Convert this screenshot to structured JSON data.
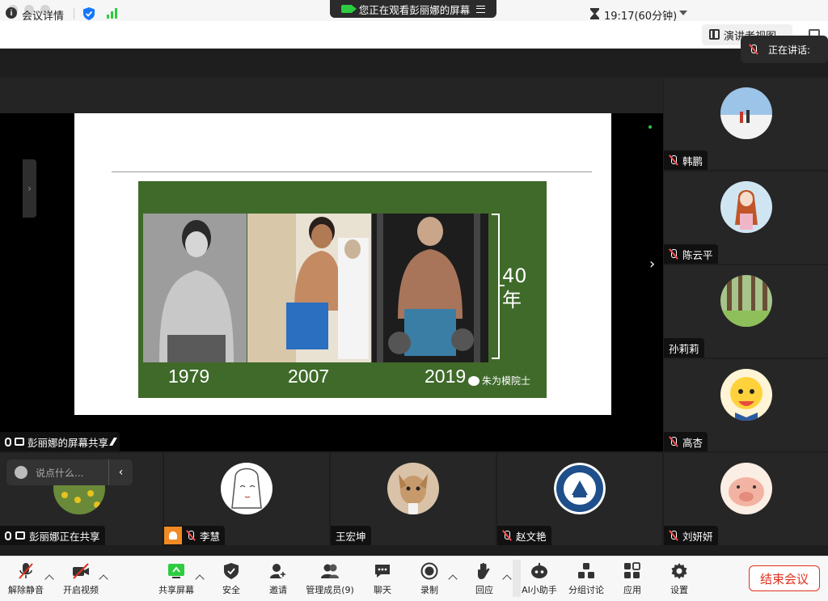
{
  "window": {
    "banner_text": "您正在观看彭丽娜的屏幕"
  },
  "infobar": {
    "meeting_details": "会议详情",
    "timer": "19:17(60分钟)",
    "speaker_view": "演讲者视图"
  },
  "talking": {
    "label": "正在讲话:"
  },
  "slide": {
    "forty": "40",
    "year_char": "年",
    "years": [
      "1979",
      "2007",
      "2019"
    ],
    "watermark": "朱为模院士"
  },
  "share_label": "彭丽娜的屏幕共享",
  "chat": {
    "placeholder": "说点什么..."
  },
  "right_panel": [
    {
      "name": "韩鹏",
      "muted": true
    },
    {
      "name": "陈云平",
      "muted": true
    },
    {
      "name": "孙莉莉",
      "muted": false
    },
    {
      "name": "高杏",
      "muted": true
    },
    {
      "name": "刘妍妍",
      "muted": true
    }
  ],
  "bottom_row": [
    {
      "name": "彭丽娜正在共享"
    },
    {
      "name": "李慧"
    },
    {
      "name": "王宏坤"
    },
    {
      "name": "赵文艳"
    }
  ],
  "toolbar": {
    "unmute": "解除静音",
    "start_video": "开启视频",
    "share_screen": "共享屏幕",
    "security": "安全",
    "invite": "邀请",
    "manage_participants": "管理成员(9)",
    "chat": "聊天",
    "record": "录制",
    "reactions": "回应",
    "ai_assistant": "AI小助手",
    "breakout_rooms": "分组讨论",
    "apps": "应用",
    "settings": "设置",
    "end_meeting": "结束会议"
  },
  "colors": {
    "accent_green": "#2ecc40",
    "end_red": "#e0301e",
    "share_blue": "#1677ff",
    "stage_bg": "#1e1e1e"
  }
}
